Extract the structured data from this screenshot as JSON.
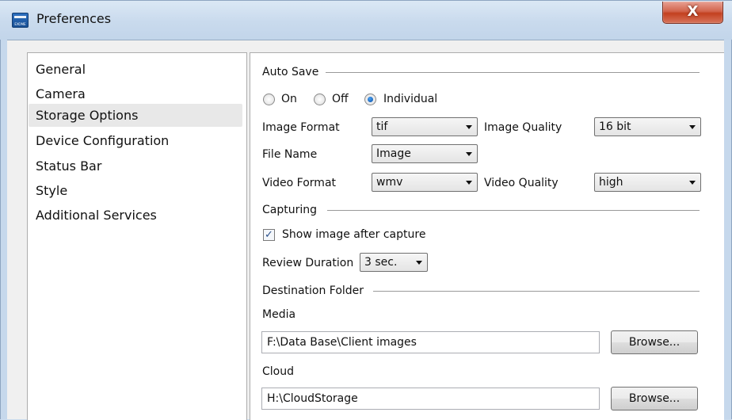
{
  "window": {
    "title": "Preferences",
    "close_label": "X",
    "icon_text": "EXOME"
  },
  "nav": {
    "items": [
      {
        "label": "General"
      },
      {
        "label": "Camera"
      },
      {
        "label": "Storage Options"
      },
      {
        "label": "Device Configuration"
      },
      {
        "label": "Status Bar"
      },
      {
        "label": "Style"
      },
      {
        "label": "Additional Services"
      }
    ],
    "selected": "Storage Options"
  },
  "auto_save": {
    "heading": "Auto Save",
    "options": [
      {
        "label": "On",
        "checked": false
      },
      {
        "label": "Off",
        "checked": false
      },
      {
        "label": "Individual",
        "checked": true
      }
    ],
    "image_format": {
      "label": "Image Format",
      "value": "tif"
    },
    "image_quality": {
      "label": "Image Quality",
      "value": "16 bit"
    },
    "file_name": {
      "label": "File Name",
      "value": "Image"
    },
    "video_format": {
      "label": "Video Format",
      "value": "wmv"
    },
    "video_quality": {
      "label": "Video Quality",
      "value": "high"
    }
  },
  "capturing": {
    "heading": "Capturing",
    "show_after_capture": {
      "label": "Show image after capture",
      "checked": true,
      "mark": "✓"
    },
    "review_duration": {
      "label": "Review Duration",
      "value": "3 sec."
    }
  },
  "destination": {
    "heading": "Destination Folder",
    "media": {
      "label": "Media",
      "path": "F:\\Data Base\\Client images",
      "browse_label": "Browse..."
    },
    "cloud": {
      "label": "Cloud",
      "path": "H:\\CloudStorage",
      "browse_label": "Browse..."
    }
  },
  "colors": {
    "accent": "#1a5bb5",
    "close": "#c7452a",
    "selected_nav": "#e8e8e8"
  }
}
